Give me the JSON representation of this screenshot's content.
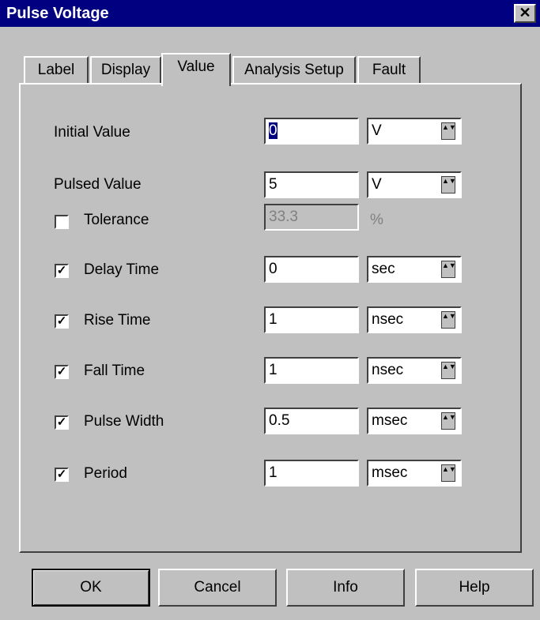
{
  "window": {
    "title": "Pulse Voltage",
    "close_glyph": "✕"
  },
  "tabs": [
    {
      "label": "Label"
    },
    {
      "label": "Display"
    },
    {
      "label": "Value"
    },
    {
      "label": "Analysis Setup"
    },
    {
      "label": "Fault"
    }
  ],
  "rows": {
    "initial": {
      "label": "Initial Value",
      "value": "0",
      "unit": "V"
    },
    "pulsed": {
      "label": "Pulsed Value",
      "value": "5",
      "unit": "V"
    },
    "tolerance": {
      "label": "Tolerance",
      "value": "33.3",
      "unit": "%",
      "checked": false
    },
    "delay": {
      "label": "Delay Time",
      "value": "0",
      "unit": "sec",
      "checked": true
    },
    "rise": {
      "label": "Rise Time",
      "value": "1",
      "unit": "nsec",
      "checked": true
    },
    "fall": {
      "label": "Fall Time",
      "value": "1",
      "unit": "nsec",
      "checked": true
    },
    "width": {
      "label": "Pulse Width",
      "value": "0.5",
      "unit": "msec",
      "checked": true
    },
    "period": {
      "label": "Period",
      "value": "1",
      "unit": "msec",
      "checked": true
    }
  },
  "check_glyph": "✓",
  "spin_glyph": "▲▼",
  "buttons": {
    "ok": "OK",
    "cancel": "Cancel",
    "info": "Info",
    "help": "Help"
  }
}
